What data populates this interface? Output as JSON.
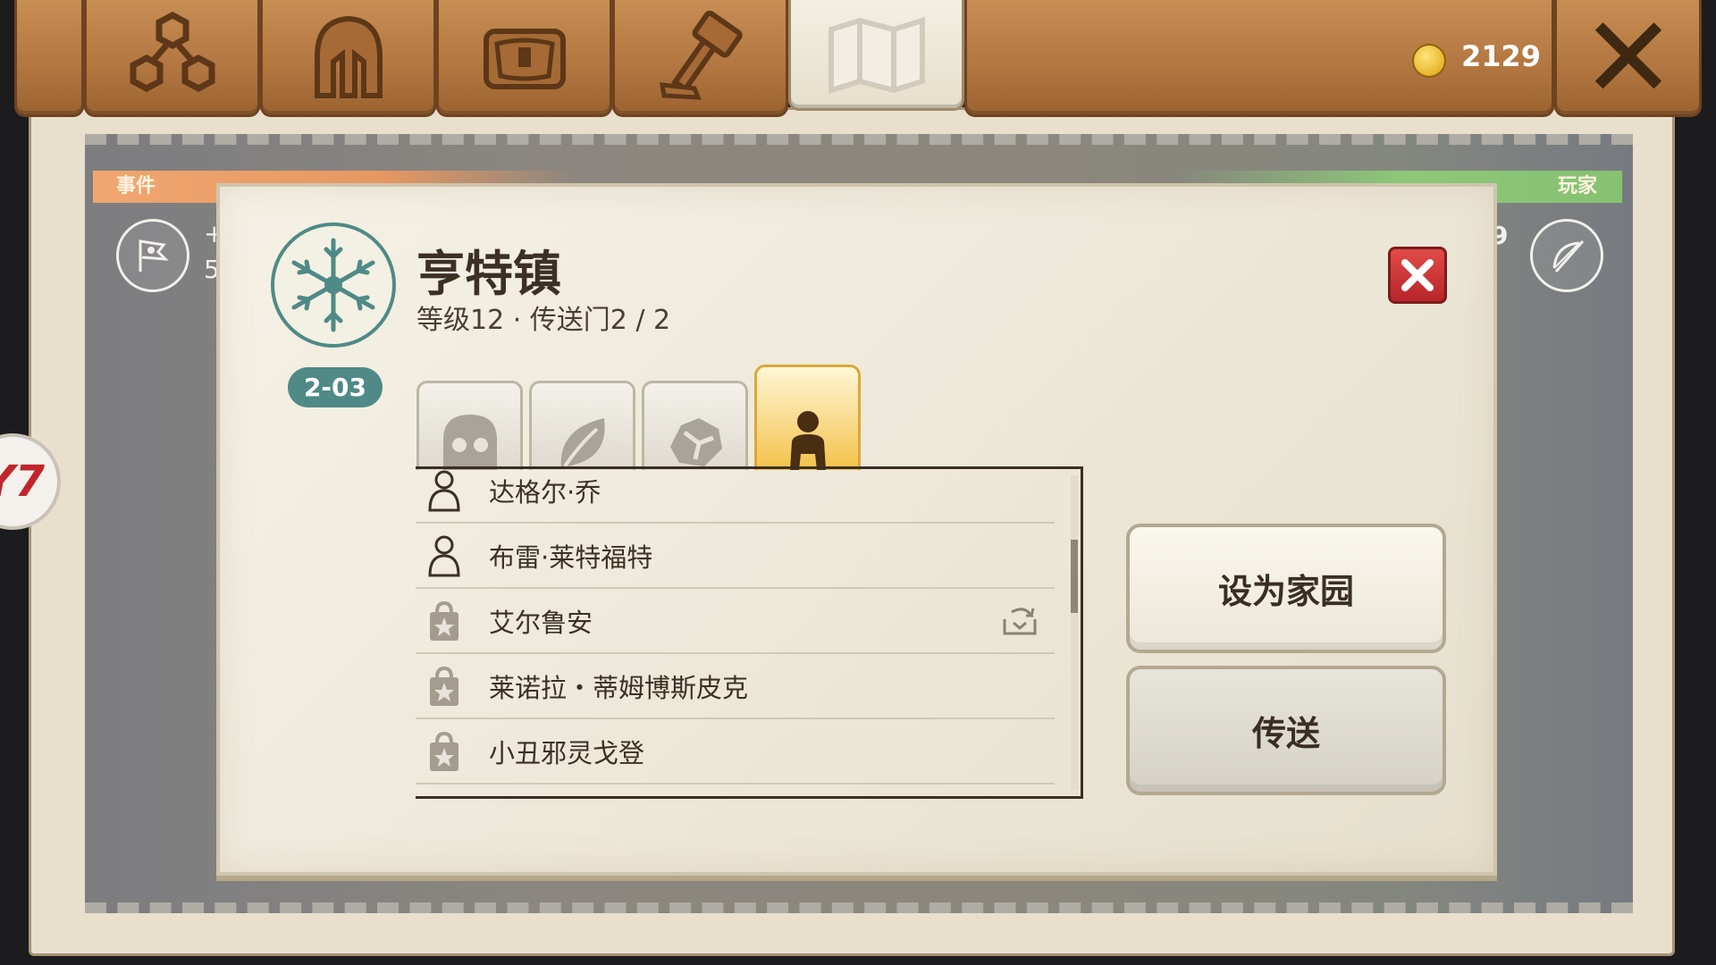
{
  "top_bar": {
    "tabs": [
      {
        "name": "team",
        "icon": "hexagon-cluster-icon"
      },
      {
        "name": "heroes",
        "icon": "helmet-icon"
      },
      {
        "name": "inventory",
        "icon": "chest-icon"
      },
      {
        "name": "crafting",
        "icon": "hammer-icon"
      },
      {
        "name": "map",
        "icon": "map-icon",
        "active": true
      }
    ],
    "currency": {
      "icon": "gold-coin-icon",
      "amount": "2129"
    },
    "close_icon": "close-x-icon"
  },
  "map_background": {
    "event_label": "事件",
    "player_label": "玩家",
    "left_partial_text_1": "+",
    "left_partial_text_2": "5",
    "right_partial_text": "9",
    "left_badge_text": "Y7"
  },
  "dialog": {
    "title": "亨特镇",
    "subtitle": "等级12 · 传送门2 / 2",
    "zone_code": "2-03",
    "emblem_icon": "snowflake-emblem-icon",
    "close_icon": "red-close-icon",
    "category_tabs": [
      {
        "icon": "skull-icon",
        "active": false
      },
      {
        "icon": "leaf-icon",
        "active": false
      },
      {
        "icon": "rock-icon",
        "active": false
      },
      {
        "icon": "person-icon",
        "active": true
      }
    ],
    "list": [
      {
        "label": "达格尔·乔",
        "icon": "player-outline-icon",
        "action_icon": ""
      },
      {
        "label": "布雷·莱特福特",
        "icon": "player-outline-icon",
        "action_icon": ""
      },
      {
        "label": "艾尔鲁安",
        "icon": "shop-bag-icon",
        "action_icon": "trade-icon"
      },
      {
        "label": "莱诺拉・蒂姆博斯皮克",
        "icon": "shop-bag-icon",
        "action_icon": ""
      },
      {
        "label": "小丑邪灵戈登",
        "icon": "shop-bag-icon",
        "action_icon": ""
      }
    ],
    "buttons": {
      "set_home": "设为家园",
      "teleport": "传送"
    }
  }
}
